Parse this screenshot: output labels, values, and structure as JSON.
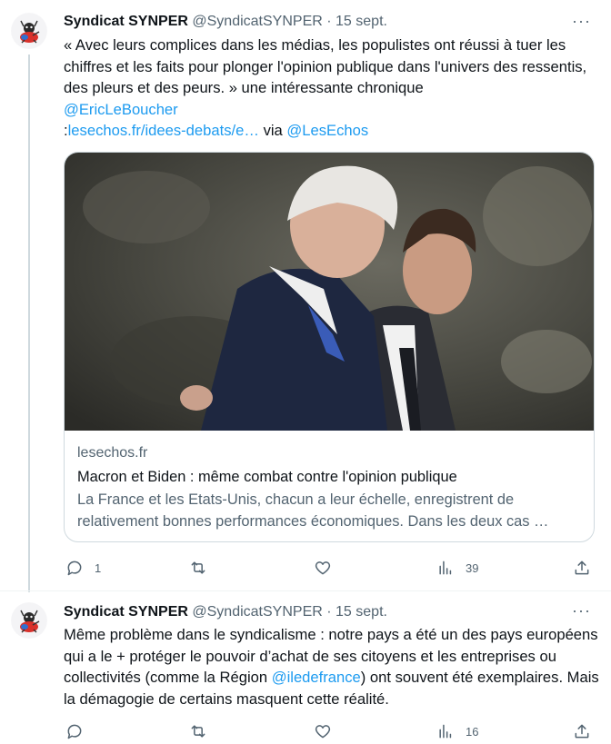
{
  "colors": {
    "link": "#1d9bf0",
    "muted": "#536471",
    "text": "#0f1419",
    "border": "#cfd9de"
  },
  "tweets": [
    {
      "author": {
        "name": "Syndicat SYNPER",
        "handle": "@SyndicatSYNPER",
        "separator": "·",
        "date": "15 sept."
      },
      "more_icon": "more-horizontal-icon",
      "text": {
        "p1": "« Avec leurs complices dans les médias, les populistes ont réussi à tuer les chiffres et les faits pour plonger l'opinion publique dans l'univers des ressentis, des pleurs et des peurs. » une intéressante chronique",
        "mention1": "@EricLeBoucher",
        "colon": ":",
        "url": "lesechos.fr/idees-debats/e…",
        "via": "via",
        "mention2": "@LesEchos"
      },
      "card": {
        "domain": "lesechos.fr",
        "title": "Macron et Biden : même combat contre l'opinion publique",
        "description": "La France et les Etats-Unis, chacun a leur échelle, enregistrent de relativement bonnes performances économiques. Dans les deux cas …"
      },
      "actions": {
        "reply": "1",
        "retweet": "",
        "like": "",
        "views": "39"
      }
    },
    {
      "author": {
        "name": "Syndicat SYNPER",
        "handle": "@SyndicatSYNPER",
        "separator": "·",
        "date": "15 sept."
      },
      "more_icon": "more-horizontal-icon",
      "text": {
        "p1": "Même problème dans le syndicalisme : notre pays a été un des pays européens qui a le + protéger le pouvoir d’achat de ses citoyens et les entreprises ou collectivités (comme la Région",
        "mention1": "@iledefrance",
        "p2": ") ont souvent été exemplaires. Mais la démagogie de certains masquent cette réalité."
      },
      "actions": {
        "reply": "",
        "retweet": "",
        "like": "",
        "views": "16"
      }
    }
  ]
}
